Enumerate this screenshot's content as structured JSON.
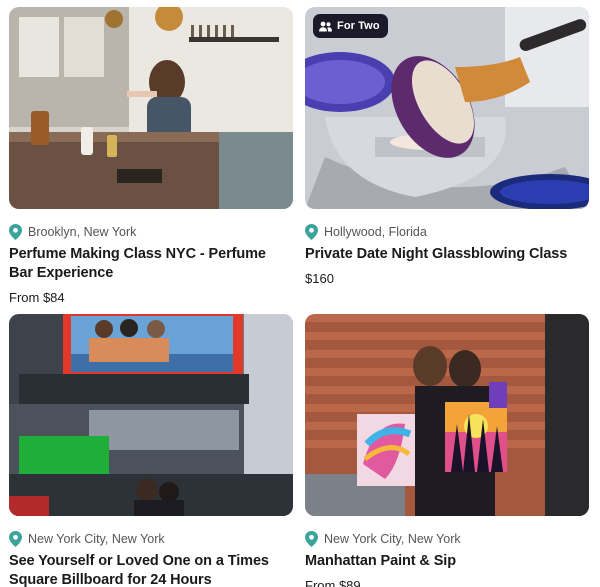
{
  "cards": [
    {
      "location": "Brooklyn, New York",
      "title": "Perfume Making Class NYC - Perfume Bar Experience",
      "price": "From $84",
      "image_alt": "Woman mixing perfume at a bar counter"
    },
    {
      "badge": "For Two",
      "location": "Hollywood, Florida",
      "title": "Private Date Night Glassblowing Class",
      "price": "$160",
      "image_alt": "Molten glass rolled in colored frit"
    },
    {
      "location": "New York City, New York",
      "title": "See Yourself or Loved One on a Times Square Billboard for 24 Hours",
      "price": "",
      "image_alt": "Times Square billboard with couple"
    },
    {
      "location": "New York City, New York",
      "title": "Manhattan Paint & Sip",
      "price": "From $89",
      "image_alt": "Two women holding paintings"
    }
  ],
  "colors": {
    "pin": "#3aa49c",
    "badge_bg": "#1c1a2a"
  },
  "icons": {
    "location": "map-pin-icon",
    "group": "two-people-icon"
  }
}
